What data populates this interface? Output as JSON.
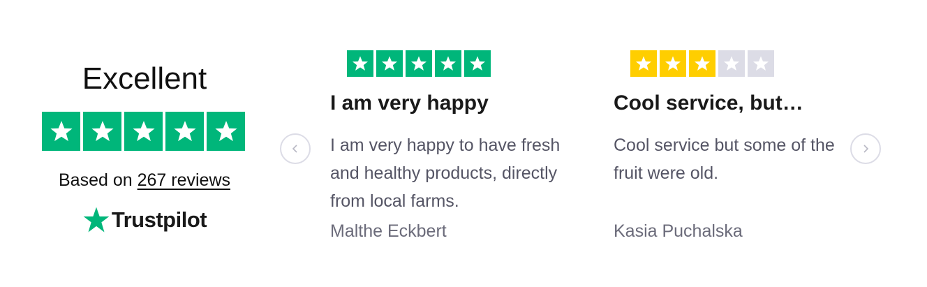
{
  "summary": {
    "rating_label": "Excellent",
    "stars": 5,
    "based_on_text": "Based on ",
    "reviews_link": "267 reviews",
    "brand": "Trustpilot"
  },
  "colors": {
    "green": "#00b67a",
    "yellow": "#ffce00",
    "grey": "#dcdce6"
  },
  "nav": {
    "prev_icon": "chevron-left-icon",
    "next_icon": "chevron-right-icon"
  },
  "reviews": [
    {
      "rating": 5,
      "title": "I am very happy",
      "body": "I am very happy to have fresh and healthy products, directly from local farms.",
      "author": "Malthe Eckbert"
    },
    {
      "rating": 3,
      "title": "Cool service, but…",
      "body": "Cool service but some of the fruit were old.",
      "author": "Kasia Puchalska"
    }
  ]
}
